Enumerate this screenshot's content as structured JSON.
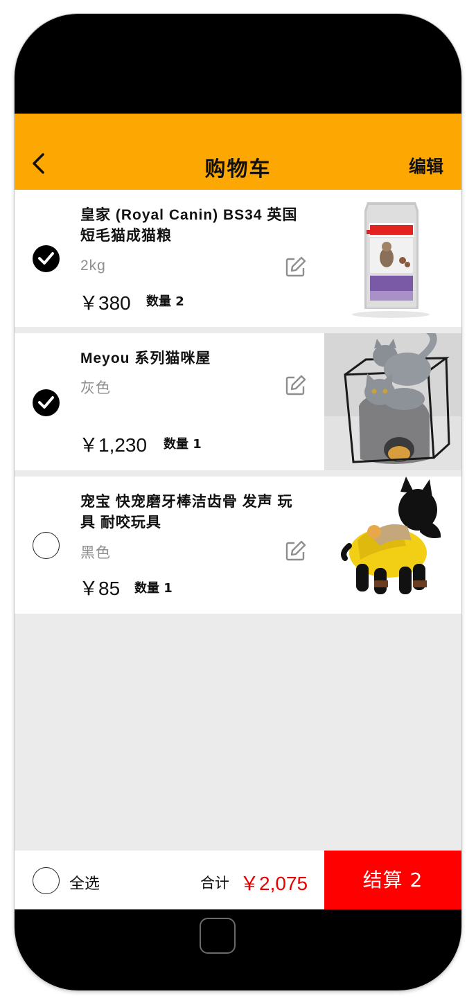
{
  "header": {
    "title": "购物车",
    "edit_label": "编辑",
    "back_icon": "chevron-left-icon",
    "bg_color": "#fca702"
  },
  "items": [
    {
      "name": "皇家 (Royal Canin) BS34 英国短毛猫成猫粮",
      "variant": "2kg",
      "price": "￥380",
      "quantity": "数量 2",
      "checked": true,
      "image": "royal-canin-bag-image"
    },
    {
      "name": "Meyou 系列猫咪屋",
      "variant": "灰色",
      "price": "￥1,230",
      "quantity": "数量 1",
      "checked": true,
      "image": "cat-house-image"
    },
    {
      "name": "宠宝 快宠磨牙棒洁齿骨 发声 玩具 耐咬玩具",
      "variant": "黑色",
      "price": "￥85",
      "quantity": "数量 1",
      "checked": false,
      "image": "dog-toy-image"
    }
  ],
  "footer": {
    "select_all_label": "全选",
    "total_label": "合计",
    "total_value": "￥2,075",
    "checkout_label": "结算 2",
    "accent_color": "#ff0000"
  }
}
